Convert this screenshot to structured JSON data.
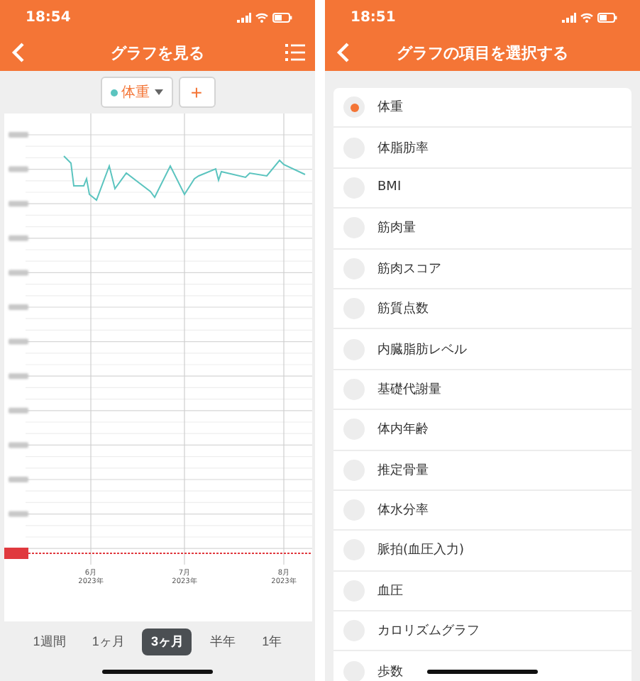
{
  "graph_screen": {
    "status_time": "18:54",
    "title": "グラフを見る",
    "selector": {
      "label": "体重",
      "color": "#5bc4bf"
    },
    "add_button": "+",
    "x_labels": [
      {
        "month": "6月",
        "year": "2023年"
      },
      {
        "month": "7月",
        "year": "2023年"
      },
      {
        "month": "8月",
        "year": "2023年"
      }
    ],
    "ranges": [
      {
        "label": "1週間",
        "selected": false
      },
      {
        "label": "1ヶ月",
        "selected": false
      },
      {
        "label": "3ヶ月",
        "selected": true
      },
      {
        "label": "半年",
        "selected": false
      },
      {
        "label": "1年",
        "selected": false
      }
    ]
  },
  "select_screen": {
    "status_time": "18:51",
    "title": "グラフの項目を選択する",
    "items": [
      {
        "label": "体重",
        "selected": true
      },
      {
        "label": "体脂肪率",
        "selected": false
      },
      {
        "label": "BMI",
        "selected": false
      },
      {
        "label": "筋肉量",
        "selected": false
      },
      {
        "label": "筋肉スコア",
        "selected": false
      },
      {
        "label": "筋質点数",
        "selected": false
      },
      {
        "label": "内臓脂肪レベル",
        "selected": false
      },
      {
        "label": "基礎代謝量",
        "selected": false
      },
      {
        "label": "体内年齢",
        "selected": false
      },
      {
        "label": "推定骨量",
        "selected": false
      },
      {
        "label": "体水分率",
        "selected": false
      },
      {
        "label": "脈拍(血圧入力)",
        "selected": false
      },
      {
        "label": "血圧",
        "selected": false
      },
      {
        "label": "カロリズムグラフ",
        "selected": false
      },
      {
        "label": "歩数",
        "selected": false
      }
    ]
  }
}
